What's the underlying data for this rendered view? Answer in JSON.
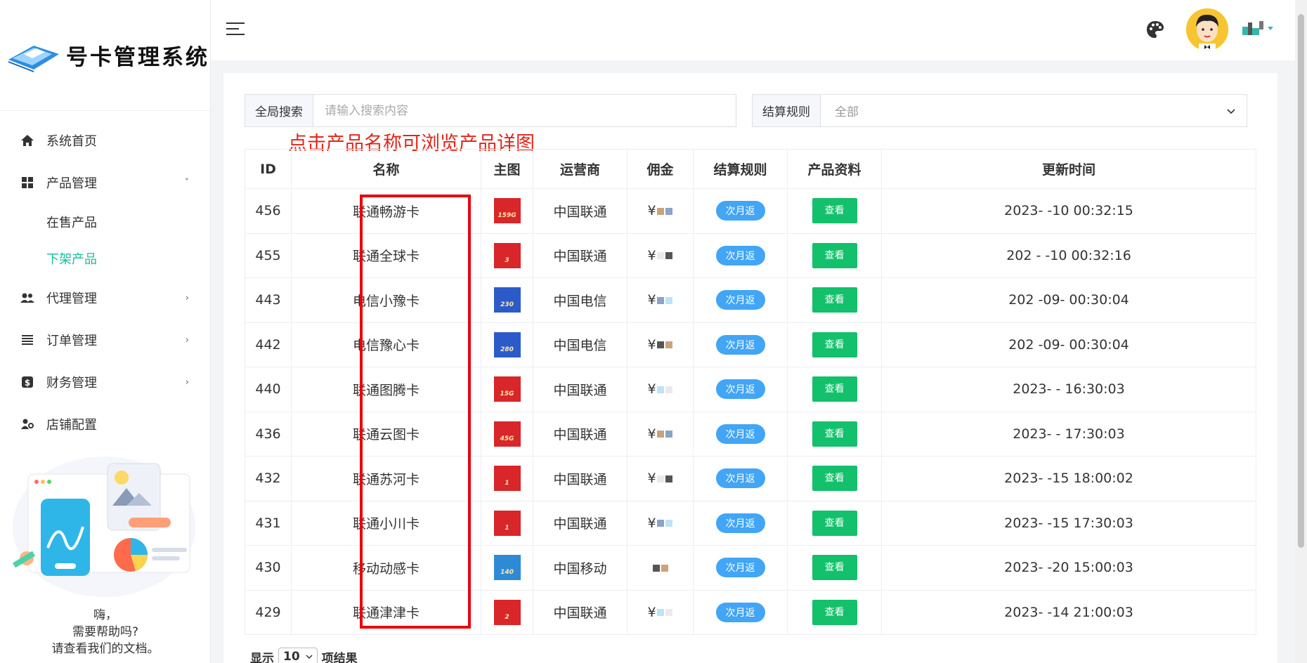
{
  "brand": {
    "title": "号卡管理系统",
    "logo_icon": "sim-card-logo-icon"
  },
  "sidebar": {
    "items": [
      {
        "label": "系统首页",
        "icon": "home-icon"
      },
      {
        "label": "产品管理",
        "icon": "grid-icon",
        "chevron": "˅"
      },
      {
        "label": "代理管理",
        "icon": "people-icon",
        "chevron": "›"
      },
      {
        "label": "订单管理",
        "icon": "list-icon",
        "chevron": "›"
      },
      {
        "label": "财务管理",
        "icon": "dollar-icon",
        "chevron": "›"
      },
      {
        "label": "店铺配置",
        "icon": "user-gear-icon"
      }
    ],
    "sub_items": [
      {
        "label": "在售产品"
      },
      {
        "label": "下架产品",
        "active": true
      }
    ],
    "help": {
      "greeting": "嗨，",
      "line1": "需要帮助吗?",
      "line2": "请查看我们的文档。"
    }
  },
  "header": {
    "menu_icon": "hamburger-icon",
    "theme_icon": "palette-icon",
    "avatar_icon": "avatar-icon"
  },
  "filters": {
    "search_label": "全局搜索",
    "search_placeholder": "请输入搜索内容",
    "rule_label": "结算规则",
    "rule_value": "全部"
  },
  "hint": "点击产品名称可浏览产品详图",
  "table": {
    "columns": [
      "ID",
      "名称",
      "主图",
      "运营商",
      "佣金",
      "结算规则",
      "产品资料",
      "更新时间"
    ],
    "rows": [
      {
        "id": "456",
        "name": "联通畅游卡",
        "thumb": "159G",
        "carrier": "中国联通",
        "commission": "¥",
        "rule": "次月返",
        "action": "查看",
        "updated": "2023-  -10 00:32:15"
      },
      {
        "id": "455",
        "name": "联通全球卡",
        "thumb": "3",
        "carrier": "中国联通",
        "commission": "¥",
        "rule": "次月返",
        "action": "查看",
        "updated": "202  -  -10 00:32:16"
      },
      {
        "id": "443",
        "name": "电信小豫卡",
        "thumb": "230",
        "carrier": "中国电信",
        "commission": "¥",
        "rule": "次月返",
        "action": "查看",
        "updated": "202  -09-   00:30:04"
      },
      {
        "id": "442",
        "name": "电信豫心卡",
        "thumb": "280",
        "carrier": "中国电信",
        "commission": "¥",
        "rule": "次月返",
        "action": "查看",
        "updated": "202  -09-   00:30:04"
      },
      {
        "id": "440",
        "name": "联通图腾卡",
        "thumb": "15G",
        "carrier": "中国联通",
        "commission": "¥",
        "rule": "次月返",
        "action": "查看",
        "updated": "2023-  -   16:30:03"
      },
      {
        "id": "436",
        "name": "联通云图卡",
        "thumb": "45G",
        "carrier": "中国联通",
        "commission": "¥",
        "rule": "次月返",
        "action": "查看",
        "updated": "2023-  -   17:30:03"
      },
      {
        "id": "432",
        "name": "联通苏河卡",
        "thumb": "1",
        "carrier": "中国联通",
        "commission": "¥",
        "rule": "次月返",
        "action": "查看",
        "updated": "2023-  -15 18:00:02"
      },
      {
        "id": "431",
        "name": "联通小川卡",
        "thumb": "1",
        "carrier": "中国联通",
        "commission": "¥",
        "rule": "次月返",
        "action": "查看",
        "updated": "2023-  -15 17:30:03"
      },
      {
        "id": "430",
        "name": "移动动感卡",
        "thumb": "140",
        "carrier": "中国移动",
        "commission": "",
        "rule": "次月返",
        "action": "查看",
        "updated": "2023-  -20 15:00:03"
      },
      {
        "id": "429",
        "name": "联通津津卡",
        "thumb": "2",
        "carrier": "中国联通",
        "commission": "¥",
        "rule": "次月返",
        "action": "查看",
        "updated": "2023-  -14 21:00:03"
      }
    ]
  },
  "pagination": {
    "show_label": "显示",
    "page_size": "10",
    "result_label": "项结果"
  },
  "colors": {
    "accent": "#19be9c",
    "badge": "#42a5f5",
    "button": "#13c06b",
    "highlight": "#e8000b"
  }
}
